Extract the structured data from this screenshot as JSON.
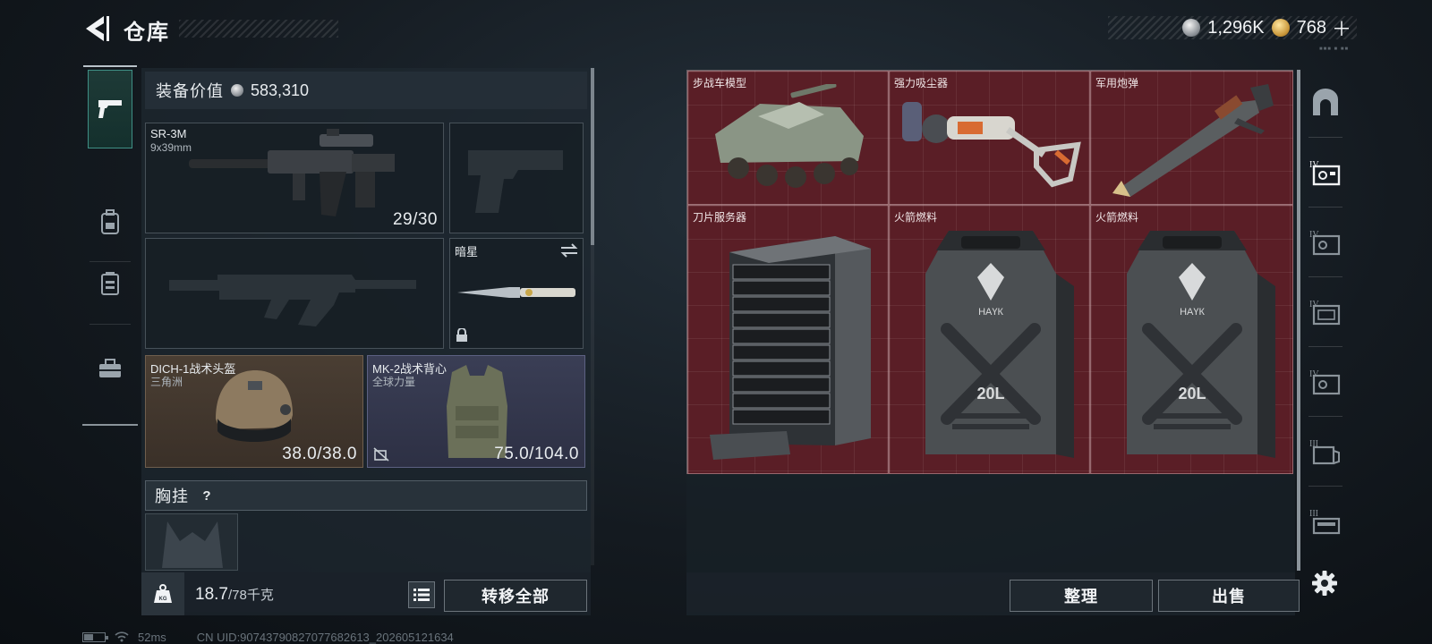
{
  "header": {
    "title": "仓库",
    "currency": {
      "silver": "1,296K",
      "gold": "768"
    },
    "plus_label": "＋",
    "mini_note": "■■■ ■ ■■"
  },
  "category_tabs": [
    {
      "icon": "pistol-icon",
      "active": true
    },
    {
      "icon": "backpack-icon",
      "active": false
    },
    {
      "icon": "chest-rig-icon",
      "active": false
    },
    {
      "icon": "toolbox-icon",
      "active": false
    }
  ],
  "loadout": {
    "value_label": "装备价值",
    "value": "583,310",
    "primary_weapon": {
      "name": "SR-3M",
      "caliber": "9x39mm",
      "ammo": "29/30"
    },
    "secondary_weapon_empty": true,
    "sidearm_empty": true,
    "melee": {
      "name": "暗星"
    },
    "helmet": {
      "name": "DICH-1战术头盔",
      "faction": "三角洲",
      "durability": "38.0/38.0"
    },
    "armor": {
      "name": "MK-2战术背心",
      "faction": "全球力量",
      "durability": "75.0/104.0"
    },
    "chest_rig": {
      "title": "胸挂",
      "help": "?"
    }
  },
  "bottom_left": {
    "weight": "18.7",
    "weight_suffix": "/78千克",
    "weight_icon_label": "KG",
    "transfer_all": "转移全部"
  },
  "storage_items": [
    {
      "name": "步战车模型"
    },
    {
      "name": "强力吸尘器"
    },
    {
      "name": "军用炮弹"
    },
    {
      "name": "刀片服务器"
    },
    {
      "name": "火箭燃料",
      "can_label": "20L",
      "brand": "НАҮК"
    },
    {
      "name": "火箭燃料",
      "can_label": "20L",
      "brand": "НАҮК"
    }
  ],
  "bottom_right": {
    "sort": "整理",
    "sell": "出售"
  },
  "storage_tabs": [
    {
      "icon": "home-arch-icon",
      "tier": ""
    },
    {
      "icon": "storage-box-icon",
      "tier": "IV"
    },
    {
      "icon": "storage-box-icon",
      "tier": "IV"
    },
    {
      "icon": "storage-box-icon",
      "tier": "IV"
    },
    {
      "icon": "storage-box-icon",
      "tier": "IV"
    },
    {
      "icon": "storage-box-icon",
      "tier": "III"
    },
    {
      "icon": "storage-box-icon",
      "tier": "III"
    }
  ],
  "status": {
    "ping": "52ms",
    "uid": "CN UID:907437908270776826​13_202605121634"
  },
  "colors": {
    "accent_teal": "#3f8f85",
    "storage_red": "#5a1e26",
    "helmet_bg": "#4a3e33",
    "vest_bg": "#3a3e55"
  }
}
